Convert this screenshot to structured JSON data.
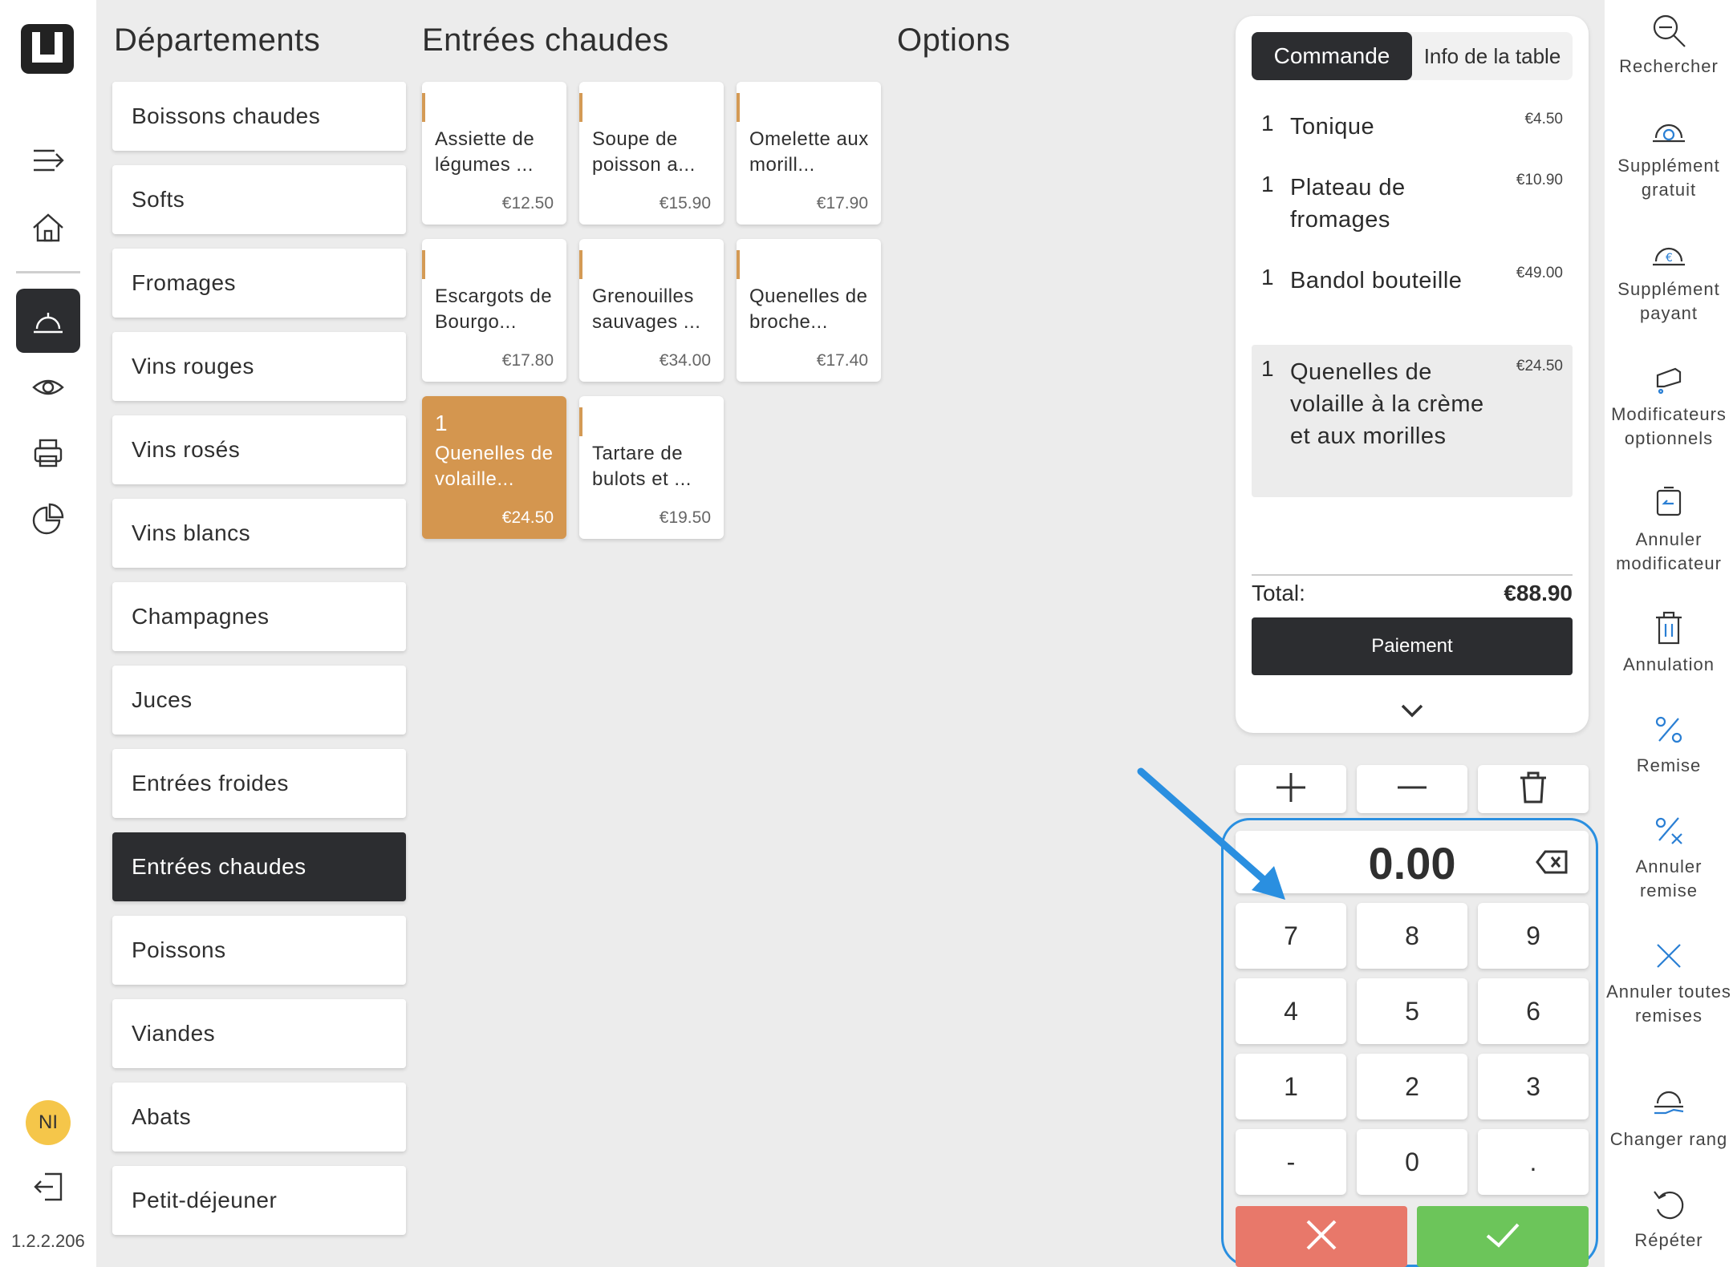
{
  "app": {
    "version": "1.2.2.206",
    "user_initials": "NI",
    "accent_color": "#2c2d30",
    "selected_product_color": "#d4964f"
  },
  "headers": {
    "departments": "Départements",
    "products": "Entrées chaudes",
    "options": "Options"
  },
  "departments": [
    "Boissons chaudes",
    "Softs",
    "Fromages",
    "Vins rouges",
    "Vins rosés",
    "Vins blancs",
    "Champagnes",
    "Juces",
    "Entrées froides",
    "Entrées chaudes",
    "Poissons",
    "Viandes",
    "Abats",
    "Petit-déjeuner"
  ],
  "selected_department": "Entrées chaudes",
  "products": [
    {
      "name": "Assiette de légumes ...",
      "price": "€12.50"
    },
    {
      "name": "Soupe de poisson a...",
      "price": "€15.90"
    },
    {
      "name": "Omelette aux morill...",
      "price": "€17.90"
    },
    {
      "name": "Escargots de Bourgo...",
      "price": "€17.80"
    },
    {
      "name": "Grenouilles sauvages ...",
      "price": "€34.00"
    },
    {
      "name": "Quenelles de broche...",
      "price": "€17.40"
    },
    {
      "name": "Quenelles de volaille...",
      "price": "€24.50",
      "qty": "1"
    },
    {
      "name": "Tartare de bulots et ...",
      "price": "€19.50"
    }
  ],
  "order": {
    "tabs": [
      "Commande",
      "Info de la table"
    ],
    "lines": [
      {
        "qty": "1",
        "name": "Tonique",
        "price": "€4.50"
      },
      {
        "qty": "1",
        "name": "Plateau de fromages",
        "price": "€10.90"
      },
      {
        "qty": "1",
        "name": "Bandol bouteille",
        "price": "€49.00"
      },
      {
        "qty": "1",
        "name": "Quenelles de volaille à la crème et aux morilles",
        "price": "€24.50"
      }
    ],
    "total_label": "Total:",
    "total_value": "€88.90",
    "pay_label": "Paiement"
  },
  "numpad": {
    "display": "0.00",
    "keys": [
      "7",
      "8",
      "9",
      "4",
      "5",
      "6",
      "1",
      "2",
      "3",
      "-",
      "0",
      "."
    ]
  },
  "tools": [
    "Rechercher",
    "Supplément gratuit",
    "Supplément payant",
    "Modificateurs optionnels",
    "Annuler modificateur",
    "Annulation",
    "Remise",
    "Annuler remise",
    "Annuler toutes remises",
    "Changer rang",
    "Répéter"
  ],
  "icons": {
    "rail": [
      "menu-collapse-icon",
      "home-icon",
      "service-bell-icon",
      "eye-icon",
      "printer-icon",
      "pie-chart-icon",
      "logout-icon"
    ],
    "tools": [
      "search-zoom-icon",
      "bell-plus-icon",
      "bell-euro-icon",
      "hand-modifier-icon",
      "undo-modifier-icon",
      "trash-icon",
      "percent-icon",
      "percent-cancel-icon",
      "close-x-icon",
      "hand-tray-icon",
      "repeat-icon"
    ]
  }
}
